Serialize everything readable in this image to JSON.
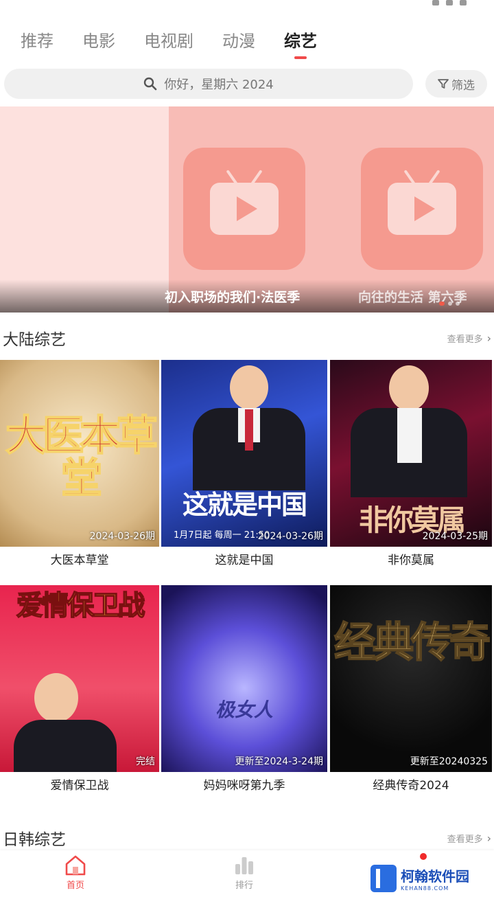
{
  "tabs": [
    {
      "label": "推荐"
    },
    {
      "label": "电影"
    },
    {
      "label": "电视剧"
    },
    {
      "label": "动漫"
    },
    {
      "label": "综艺"
    }
  ],
  "active_tab": "综艺",
  "search": {
    "placeholder": "你好，星期六 2024"
  },
  "filter": {
    "label": "筛选"
  },
  "banner": {
    "captions": [
      "初入职场的我们·法医季",
      "向往的生活 第六季"
    ]
  },
  "sections": [
    {
      "title": "大陆综艺",
      "more": "查看更多",
      "items": [
        {
          "name": "大医本草堂",
          "poster_title": "大医本草堂",
          "ep": "2024-03-26期"
        },
        {
          "name": "这就是中国",
          "poster_title": "这就是中国",
          "poster_sub": "1月7日起 每周一 21:50",
          "ep": "2024-03-26期"
        },
        {
          "name": "非你莫属",
          "poster_title": "非你莫属",
          "ep": "2024-03-25期"
        },
        {
          "name": "爱情保卫战",
          "poster_title": "爱情保卫战",
          "ep": "完结"
        },
        {
          "name": "妈妈咪呀第九季",
          "poster_title": "极女人",
          "ep": "更新至2024-3-24期"
        },
        {
          "name": "经典传奇2024",
          "poster_title": "经典传奇",
          "ep": "更新至20240325"
        }
      ]
    },
    {
      "title": "日韩综艺",
      "more": "查看更多"
    }
  ],
  "bottom_nav": [
    {
      "label": "首页",
      "icon": "home-icon"
    },
    {
      "label": "排行",
      "icon": "ranking-icon"
    }
  ],
  "watermark": {
    "name": "柯翰软件园",
    "url": "KEHAN88.COM"
  },
  "colors": {
    "accent": "#f04a4a",
    "banner_bg": "#fde1de",
    "banner_tile": "#f59a8f"
  }
}
